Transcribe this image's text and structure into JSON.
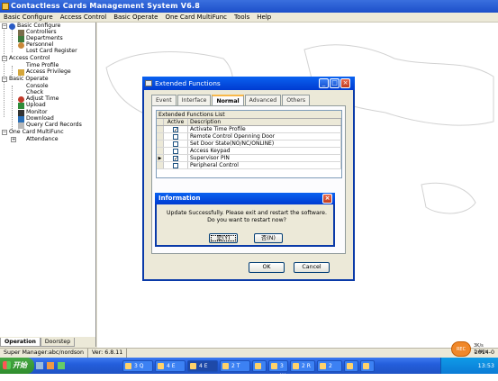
{
  "app": {
    "title": "Contactless Cards Management System  V6.8"
  },
  "menu": [
    "Basic Configure",
    "Access Control",
    "Basic Operate",
    "One Card MultiFunc",
    "Tools",
    "Help"
  ],
  "tree": {
    "groups": [
      {
        "label": "Basic Configure",
        "children": [
          "Controllers",
          "Departments",
          "Personnel",
          "Lost Card Register"
        ]
      },
      {
        "label": "Access Control",
        "children": [
          "Time Profile",
          "Access Privilege"
        ]
      },
      {
        "label": "Basic Operate",
        "children": [
          "Console",
          "Check",
          "Adjust Time",
          "Upload",
          "Monitor",
          "Download",
          "Query Card Records"
        ]
      },
      {
        "label": "One Card MultiFunc",
        "children": [
          "Attendance"
        ]
      }
    ]
  },
  "left_tabs": [
    "Operation",
    "Doorstep"
  ],
  "status": {
    "user": "Super Manager:abc/nordson",
    "version": "Ver: 6.8.11",
    "date": "2014-0"
  },
  "dialog": {
    "title": "Extended Functions",
    "tabs": [
      "Event",
      "Interface",
      "Normal",
      "Advanced",
      "Others"
    ],
    "list_title": "Extended Functions List",
    "columns": [
      "Active",
      "Description"
    ],
    "rows": [
      {
        "active": true,
        "desc": "Activate Time Profile"
      },
      {
        "active": false,
        "desc": "Remote Control Openning Door"
      },
      {
        "active": false,
        "desc": "Set Door State(NO/NC/ONLINE)"
      },
      {
        "active": false,
        "desc": "Access Keypad"
      },
      {
        "active": true,
        "desc": "Supervisor PIN"
      },
      {
        "active": false,
        "desc": "Peripheral Control"
      }
    ],
    "ok": "OK",
    "cancel": "Cancel"
  },
  "info": {
    "title": "Information",
    "line1": "Update Successfully. Please exit and restart the software.",
    "line2": "Do you want to restart now?",
    "yes": "是(Y)",
    "no": "否(N)"
  },
  "taskbar": {
    "start": "开始",
    "items": [
      "3 Q",
      "4 E",
      "4 E",
      "2 T",
      "",
      "3 W",
      "2 R",
      "2 ",
      "",
      ""
    ],
    "clock": "13:53"
  },
  "recorder": {
    "label": "REC",
    "up": "3K/s",
    "down": "1.4K/s"
  }
}
